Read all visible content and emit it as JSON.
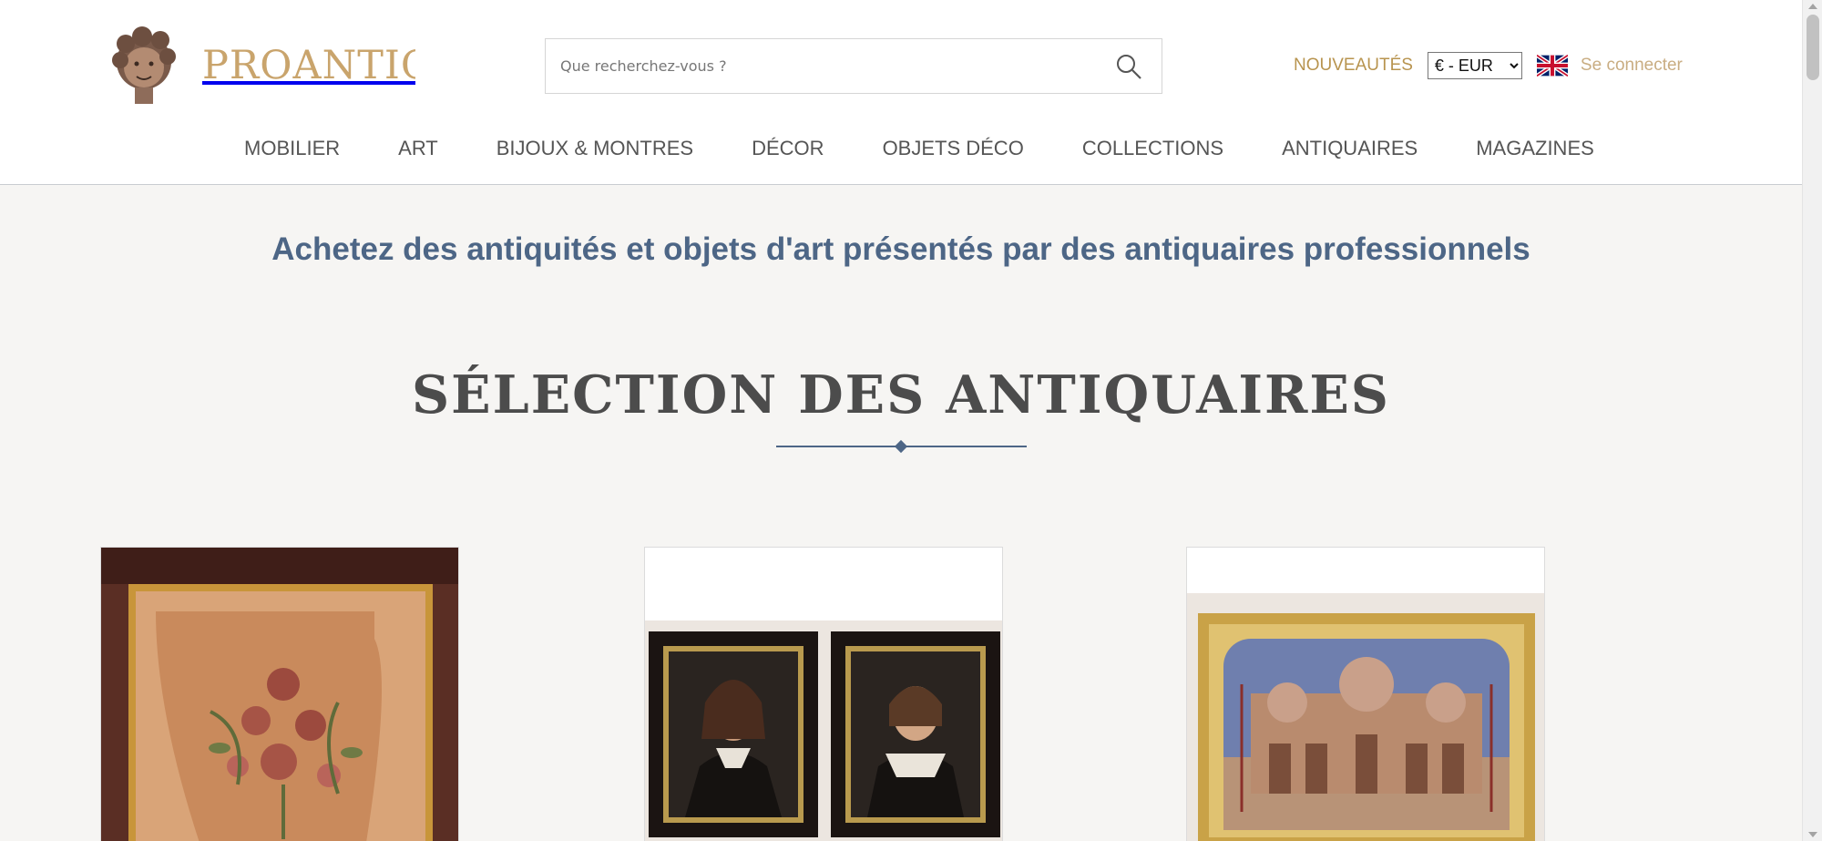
{
  "brand": {
    "name": "PROANTIC",
    "logo_icon": "cherub-head-icon"
  },
  "search": {
    "placeholder": "Que recherchez-vous ?",
    "icon": "search-icon"
  },
  "top_links": {
    "new_label": "NOUVEAUTÉS",
    "currency": {
      "selected": "€ - EUR",
      "options": [
        "€ - EUR"
      ]
    },
    "language_icon": "uk-flag-icon",
    "login_label": "Se connecter"
  },
  "nav": {
    "items": [
      {
        "label": "MOBILIER"
      },
      {
        "label": "ART"
      },
      {
        "label": "BIJOUX & MONTRES"
      },
      {
        "label": "DÉCOR"
      },
      {
        "label": "OBJETS DÉCO"
      },
      {
        "label": "COLLECTIONS"
      },
      {
        "label": "ANTIQUAIRES"
      },
      {
        "label": "MAGAZINES"
      }
    ]
  },
  "tagline": "Achetez des antiquités et objets d'art présentés par des antiquaires professionnels",
  "selection": {
    "title": "SÉLECTION DES ANTIQUAIRES",
    "cards": [
      {
        "image": "framed-floral-embroidery-image"
      },
      {
        "image": "pair-of-dutch-portraits-image"
      },
      {
        "image": "venice-san-marco-painting-image"
      }
    ]
  },
  "colors": {
    "brand_gold": "#c9a46c",
    "nav_text": "#555555",
    "tagline_blue": "#4d6686",
    "page_bg": "#f6f5f3"
  }
}
